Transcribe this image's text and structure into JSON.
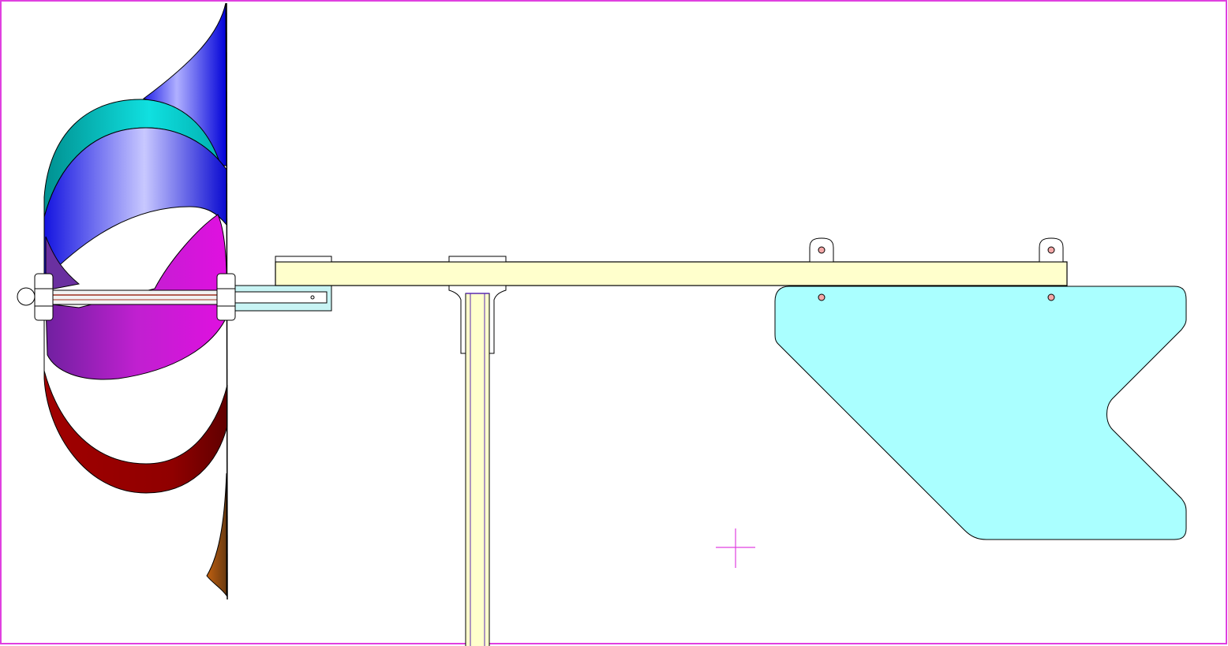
{
  "drawing": {
    "view": "side view",
    "frame_color": "#e040e0",
    "cursor_color": "#e040e0"
  },
  "rotor": {
    "blade_colors": {
      "upper_blue": "#1010e8",
      "upper_cyan": "#00d0d0",
      "middle_magenta": "#d010d0",
      "lower_red": "#a00000",
      "lower_brown": "#8a4a10"
    },
    "shaft_color": "#f0f0f0"
  },
  "boom": {
    "color": "#ffffcc",
    "outline": "#000000"
  },
  "mast": {
    "color": "#ffffcc",
    "inner_stroke": "#5a2ab0"
  },
  "tail_vane": {
    "color": "#aaffff",
    "hole_color": "#f4a8a8"
  },
  "shaft_bracket": {
    "color": "#c8f4f4"
  }
}
